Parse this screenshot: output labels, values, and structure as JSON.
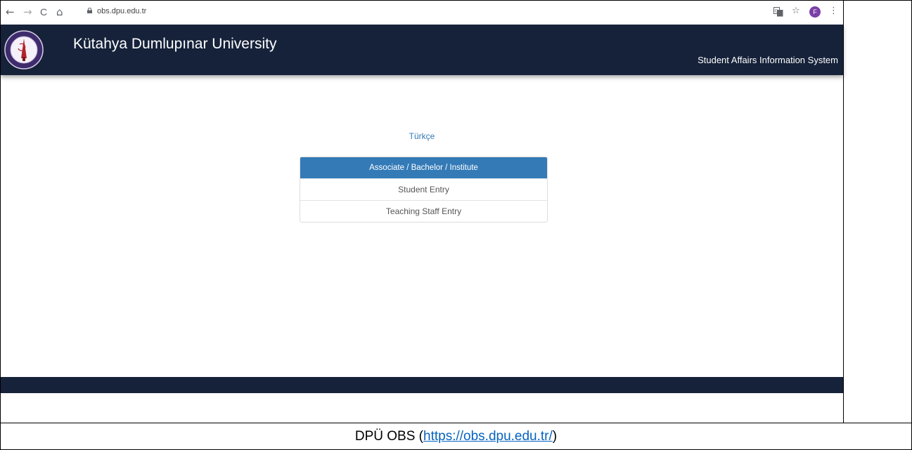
{
  "browser": {
    "url": "obs.dpu.edu.tr",
    "back_icon": "←",
    "forward_icon": "→",
    "reload_icon": "C",
    "home_icon": "⌂",
    "translate_icon": "translate-icon",
    "star_icon": "☆",
    "profile_initial": "F",
    "menu_icon": "⋮"
  },
  "header": {
    "university_name": "Kütahya Dumlupınar University",
    "system_name": "Student Affairs Information System",
    "background_color": "#16223a"
  },
  "login": {
    "language_link": "Türkçe",
    "panel_title": "Associate / Bachelor / Institute",
    "items": [
      {
        "label": "Student Entry"
      },
      {
        "label": "Teaching Staff Entry"
      }
    ],
    "accent_color": "#337ab7"
  },
  "caption": {
    "prefix": "DPÜ OBS (",
    "link": "https://obs.dpu.edu.tr/",
    "suffix": ")"
  }
}
